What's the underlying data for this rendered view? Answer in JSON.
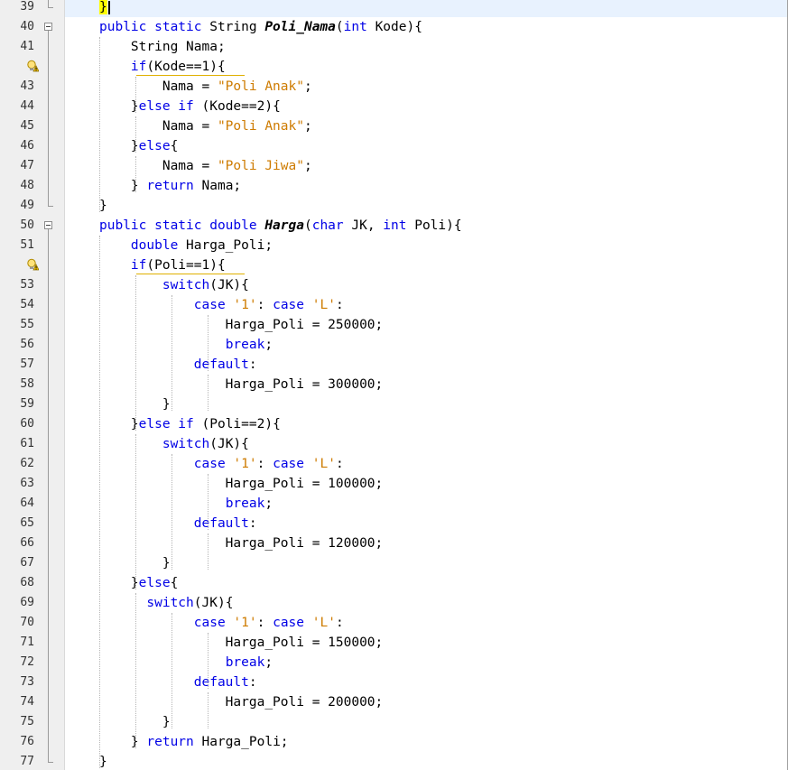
{
  "editor": {
    "lines": [
      {
        "num": "39",
        "tokens": [
          {
            "t": "}",
            "c": "brace"
          }
        ]
      },
      {
        "num": "40",
        "tokens": [
          {
            "t": "public static ",
            "c": "kw"
          },
          {
            "t": "String ",
            "c": "plain"
          },
          {
            "t": "Poli_Nama",
            "c": "meth"
          },
          {
            "t": "(",
            "c": "plain"
          },
          {
            "t": "int ",
            "c": "kw"
          },
          {
            "t": "Kode){",
            "c": "plain"
          }
        ]
      },
      {
        "num": "41",
        "tokens": [
          {
            "t": "    String Nama;",
            "c": "plain"
          }
        ]
      },
      {
        "num": "",
        "hint": true,
        "tokens": [
          {
            "t": "    ",
            "c": "plain"
          },
          {
            "t": "if",
            "c": "kw"
          },
          {
            "t": "(Kode==1){",
            "c": "plain"
          }
        ]
      },
      {
        "num": "43",
        "tokens": [
          {
            "t": "        Nama = ",
            "c": "plain"
          },
          {
            "t": "\"Poli Anak\"",
            "c": "str"
          },
          {
            "t": ";",
            "c": "plain"
          }
        ]
      },
      {
        "num": "44",
        "tokens": [
          {
            "t": "    }",
            "c": "plain"
          },
          {
            "t": "else if ",
            "c": "kw"
          },
          {
            "t": "(Kode==2){",
            "c": "plain"
          }
        ]
      },
      {
        "num": "45",
        "tokens": [
          {
            "t": "        Nama = ",
            "c": "plain"
          },
          {
            "t": "\"Poli Anak\"",
            "c": "str"
          },
          {
            "t": ";",
            "c": "plain"
          }
        ]
      },
      {
        "num": "46",
        "tokens": [
          {
            "t": "    }",
            "c": "plain"
          },
          {
            "t": "else",
            "c": "kw"
          },
          {
            "t": "{",
            "c": "plain"
          }
        ]
      },
      {
        "num": "47",
        "tokens": [
          {
            "t": "        Nama = ",
            "c": "plain"
          },
          {
            "t": "\"Poli Jiwa\"",
            "c": "str"
          },
          {
            "t": ";",
            "c": "plain"
          }
        ]
      },
      {
        "num": "48",
        "tokens": [
          {
            "t": "    } ",
            "c": "plain"
          },
          {
            "t": "return ",
            "c": "kw"
          },
          {
            "t": "Nama;",
            "c": "plain"
          }
        ]
      },
      {
        "num": "49",
        "tokens": [
          {
            "t": "}",
            "c": "plain"
          }
        ]
      },
      {
        "num": "50",
        "tokens": [
          {
            "t": "public static double ",
            "c": "kw"
          },
          {
            "t": "Harga",
            "c": "meth"
          },
          {
            "t": "(",
            "c": "plain"
          },
          {
            "t": "char ",
            "c": "kw"
          },
          {
            "t": "JK, ",
            "c": "plain"
          },
          {
            "t": "int ",
            "c": "kw"
          },
          {
            "t": "Poli){",
            "c": "plain"
          }
        ]
      },
      {
        "num": "51",
        "tokens": [
          {
            "t": "    ",
            "c": "plain"
          },
          {
            "t": "double ",
            "c": "kw"
          },
          {
            "t": "Harga_Poli;",
            "c": "plain"
          }
        ]
      },
      {
        "num": "",
        "hint": true,
        "tokens": [
          {
            "t": "    ",
            "c": "plain"
          },
          {
            "t": "if",
            "c": "kw"
          },
          {
            "t": "(Poli==1){",
            "c": "plain"
          }
        ]
      },
      {
        "num": "53",
        "tokens": [
          {
            "t": "        ",
            "c": "plain"
          },
          {
            "t": "switch",
            "c": "kw"
          },
          {
            "t": "(JK){",
            "c": "plain"
          }
        ]
      },
      {
        "num": "54",
        "tokens": [
          {
            "t": "            ",
            "c": "plain"
          },
          {
            "t": "case ",
            "c": "kw"
          },
          {
            "t": "'1'",
            "c": "str"
          },
          {
            "t": ": ",
            "c": "plain"
          },
          {
            "t": "case ",
            "c": "kw"
          },
          {
            "t": "'L'",
            "c": "str"
          },
          {
            "t": ":",
            "c": "plain"
          }
        ]
      },
      {
        "num": "55",
        "tokens": [
          {
            "t": "                Harga_Poli = 250000;",
            "c": "plain"
          }
        ]
      },
      {
        "num": "56",
        "tokens": [
          {
            "t": "                ",
            "c": "plain"
          },
          {
            "t": "break",
            "c": "kw"
          },
          {
            "t": ";",
            "c": "plain"
          }
        ]
      },
      {
        "num": "57",
        "tokens": [
          {
            "t": "            ",
            "c": "plain"
          },
          {
            "t": "default",
            "c": "kw"
          },
          {
            "t": ":",
            "c": "plain"
          }
        ]
      },
      {
        "num": "58",
        "tokens": [
          {
            "t": "                Harga_Poli = 300000;",
            "c": "plain"
          }
        ]
      },
      {
        "num": "59",
        "tokens": [
          {
            "t": "        }",
            "c": "plain"
          }
        ]
      },
      {
        "num": "60",
        "tokens": [
          {
            "t": "    }",
            "c": "plain"
          },
          {
            "t": "else if ",
            "c": "kw"
          },
          {
            "t": "(Poli==2){",
            "c": "plain"
          }
        ]
      },
      {
        "num": "61",
        "tokens": [
          {
            "t": "        ",
            "c": "plain"
          },
          {
            "t": "switch",
            "c": "kw"
          },
          {
            "t": "(JK){",
            "c": "plain"
          }
        ]
      },
      {
        "num": "62",
        "tokens": [
          {
            "t": "            ",
            "c": "plain"
          },
          {
            "t": "case ",
            "c": "kw"
          },
          {
            "t": "'1'",
            "c": "str"
          },
          {
            "t": ": ",
            "c": "plain"
          },
          {
            "t": "case ",
            "c": "kw"
          },
          {
            "t": "'L'",
            "c": "str"
          },
          {
            "t": ":",
            "c": "plain"
          }
        ]
      },
      {
        "num": "63",
        "tokens": [
          {
            "t": "                Harga_Poli = 100000;",
            "c": "plain"
          }
        ]
      },
      {
        "num": "64",
        "tokens": [
          {
            "t": "                ",
            "c": "plain"
          },
          {
            "t": "break",
            "c": "kw"
          },
          {
            "t": ";",
            "c": "plain"
          }
        ]
      },
      {
        "num": "65",
        "tokens": [
          {
            "t": "            ",
            "c": "plain"
          },
          {
            "t": "default",
            "c": "kw"
          },
          {
            "t": ":",
            "c": "plain"
          }
        ]
      },
      {
        "num": "66",
        "tokens": [
          {
            "t": "                Harga_Poli = 120000;",
            "c": "plain"
          }
        ]
      },
      {
        "num": "67",
        "tokens": [
          {
            "t": "        }",
            "c": "plain"
          }
        ]
      },
      {
        "num": "68",
        "tokens": [
          {
            "t": "    }",
            "c": "plain"
          },
          {
            "t": "else",
            "c": "kw"
          },
          {
            "t": "{",
            "c": "plain"
          }
        ]
      },
      {
        "num": "69",
        "tokens": [
          {
            "t": "      ",
            "c": "plain"
          },
          {
            "t": "switch",
            "c": "kw"
          },
          {
            "t": "(JK){",
            "c": "plain"
          }
        ]
      },
      {
        "num": "70",
        "tokens": [
          {
            "t": "            ",
            "c": "plain"
          },
          {
            "t": "case ",
            "c": "kw"
          },
          {
            "t": "'1'",
            "c": "str"
          },
          {
            "t": ": ",
            "c": "plain"
          },
          {
            "t": "case ",
            "c": "kw"
          },
          {
            "t": "'L'",
            "c": "str"
          },
          {
            "t": ":",
            "c": "plain"
          }
        ]
      },
      {
        "num": "71",
        "tokens": [
          {
            "t": "                Harga_Poli = 150000;",
            "c": "plain"
          }
        ]
      },
      {
        "num": "72",
        "tokens": [
          {
            "t": "                ",
            "c": "plain"
          },
          {
            "t": "break",
            "c": "kw"
          },
          {
            "t": ";",
            "c": "plain"
          }
        ]
      },
      {
        "num": "73",
        "tokens": [
          {
            "t": "            ",
            "c": "plain"
          },
          {
            "t": "default",
            "c": "kw"
          },
          {
            "t": ":",
            "c": "plain"
          }
        ]
      },
      {
        "num": "74",
        "tokens": [
          {
            "t": "                Harga_Poli = 200000;",
            "c": "plain"
          }
        ]
      },
      {
        "num": "75",
        "tokens": [
          {
            "t": "        }",
            "c": "plain"
          }
        ]
      },
      {
        "num": "76",
        "tokens": [
          {
            "t": "    } ",
            "c": "plain"
          },
          {
            "t": "return ",
            "c": "kw"
          },
          {
            "t": "Harga_Poli;",
            "c": "plain"
          }
        ]
      },
      {
        "num": "77",
        "tokens": [
          {
            "t": "}",
            "c": "plain"
          }
        ]
      }
    ],
    "hint_icon": "warning-bulb-icon",
    "fold_icon": "fold-collapse-icon",
    "colors": {
      "keyword": "#0000e6",
      "string": "#ce7b00",
      "current_line": "#e8f2fe",
      "brace_match": "#ffff00",
      "gutter": "#efefef"
    }
  }
}
